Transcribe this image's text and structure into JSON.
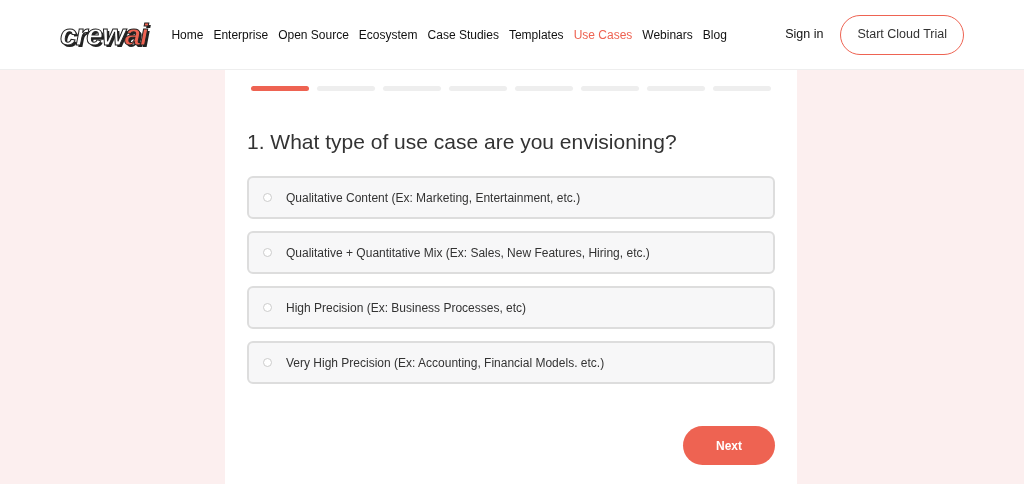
{
  "header": {
    "logo": {
      "part_1": "crew",
      "part_2": "ai"
    },
    "nav": [
      {
        "label": "Home",
        "selected": false
      },
      {
        "label": "Enterprise",
        "selected": false
      },
      {
        "label": "Open Source",
        "selected": false
      },
      {
        "label": "Ecosystem",
        "selected": false
      },
      {
        "label": "Case Studies",
        "selected": false
      },
      {
        "label": "Templates",
        "selected": false
      },
      {
        "label": "Use Cases",
        "selected": true
      },
      {
        "label": "Webinars",
        "selected": false
      },
      {
        "label": "Blog",
        "selected": false
      }
    ],
    "sign_in": "Sign in",
    "cta": "Start Cloud Trial"
  },
  "progress": [
    {
      "done": true
    },
    {
      "done": false
    },
    {
      "done": false
    },
    {
      "done": false
    },
    {
      "done": false
    },
    {
      "done": false
    },
    {
      "done": false
    },
    {
      "done": false
    }
  ],
  "question": "1. What type of use case are you envisioning?",
  "options": [
    {
      "label": "Qualitative Content (Ex: Marketing, Entertainment, etc.)",
      "selected": false
    },
    {
      "label": "Qualitative + Quantitative Mix (Ex: Sales, New Features, Hiring, etc.)",
      "selected": false
    },
    {
      "label": "High Precision (Ex: Business Processes, etc)",
      "selected": false
    },
    {
      "label": "Very High Precision (Ex: Accounting, Financial Models. etc.)",
      "selected": false
    }
  ],
  "next_button": "Next"
}
